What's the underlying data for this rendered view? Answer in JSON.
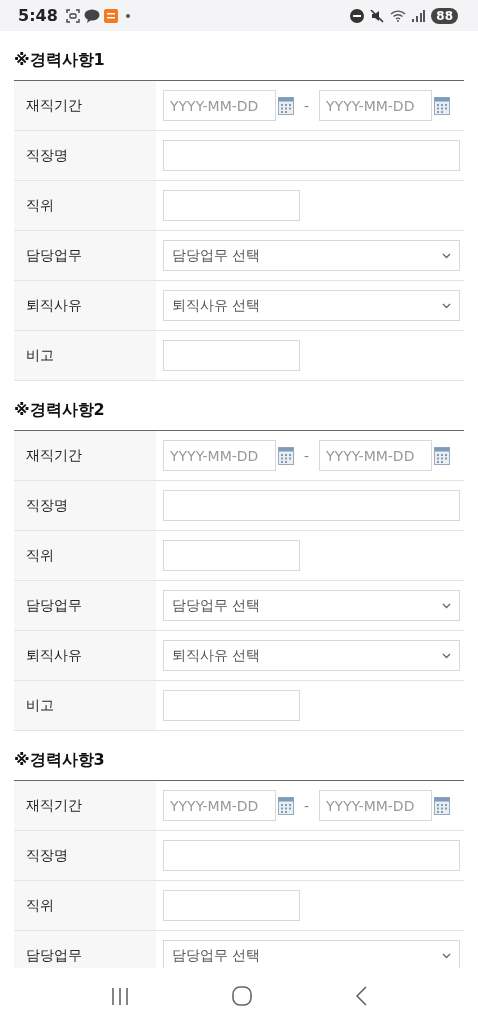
{
  "status_bar": {
    "time": "5:48",
    "battery": "88"
  },
  "sections": [
    {
      "title": "※경력사항1",
      "rows": [
        {
          "kind": "date_range",
          "label": "재직기간",
          "start_placeholder": "YYYY-MM-DD",
          "separator": "-",
          "end_placeholder": "YYYY-MM-DD"
        },
        {
          "kind": "text_wide",
          "label": "직장명"
        },
        {
          "kind": "text_short",
          "label": "직위"
        },
        {
          "kind": "select",
          "label": "담당업무",
          "value": "담당업무 선택"
        },
        {
          "kind": "select",
          "label": "퇴직사유",
          "value": "퇴직사유 선택"
        },
        {
          "kind": "text_short",
          "label": "비고"
        }
      ]
    },
    {
      "title": "※경력사항2",
      "rows": [
        {
          "kind": "date_range",
          "label": "재직기간",
          "start_placeholder": "YYYY-MM-DD",
          "separator": "-",
          "end_placeholder": "YYYY-MM-DD"
        },
        {
          "kind": "text_wide",
          "label": "직장명"
        },
        {
          "kind": "text_short",
          "label": "직위"
        },
        {
          "kind": "select",
          "label": "담당업무",
          "value": "담당업무 선택"
        },
        {
          "kind": "select",
          "label": "퇴직사유",
          "value": "퇴직사유 선택"
        },
        {
          "kind": "text_short",
          "label": "비고"
        }
      ]
    },
    {
      "title": "※경력사항3",
      "rows": [
        {
          "kind": "date_range",
          "label": "재직기간",
          "start_placeholder": "YYYY-MM-DD",
          "separator": "-",
          "end_placeholder": "YYYY-MM-DD"
        },
        {
          "kind": "text_wide",
          "label": "직장명"
        },
        {
          "kind": "text_short",
          "label": "직위"
        },
        {
          "kind": "select",
          "label": "담당업무",
          "value": "담당업무 선택"
        }
      ]
    }
  ]
}
